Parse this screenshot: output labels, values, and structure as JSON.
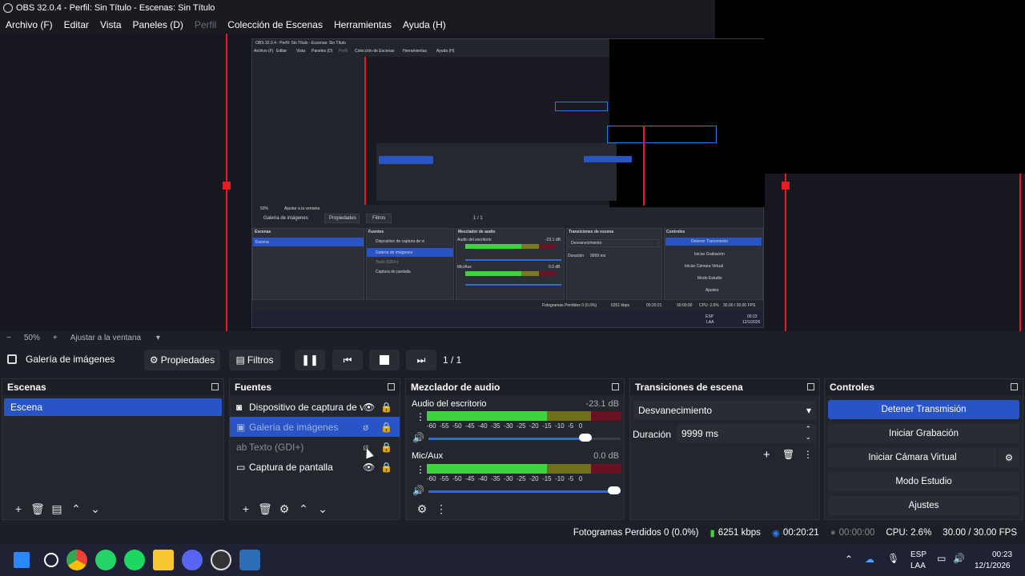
{
  "window": {
    "title": "OBS 32.0.4 - Perfil: Sin Título - Escenas: Sin Título"
  },
  "menu": [
    "Archivo (F)",
    "Editar",
    "Vista",
    "Paneles (D)",
    "Perfil",
    "Colección de Escenas",
    "Herramientas",
    "Ayuda (H)"
  ],
  "zoom": {
    "minus": "−",
    "value": "50%",
    "plus": "+",
    "fit": "Ajustar a la ventana"
  },
  "toolbar": {
    "source_name": "Galería de imágenes",
    "properties": "Propiedades",
    "filters": "Filtros",
    "slide_counter": "1 / 1"
  },
  "docks": {
    "scenes": {
      "title": "Escenas",
      "items": [
        "Escena"
      ]
    },
    "sources": {
      "title": "Fuentes",
      "items": [
        {
          "label": "Dispositivo de captura de vi",
          "icon": "camera-icon"
        },
        {
          "label": "Galería de imágenes",
          "icon": "image-icon"
        },
        {
          "label": "Texto (GDI+)",
          "icon": "text-icon"
        },
        {
          "label": "Captura de pantalla",
          "icon": "monitor-icon"
        }
      ]
    },
    "mixer": {
      "title": "Mezclador de audio",
      "channels": [
        {
          "name": "Audio del escritorio",
          "db": "-23.1 dB",
          "volume_fraction": 0.85
        },
        {
          "name": "Mic/Aux",
          "db": "0.0 dB",
          "volume_fraction": 1.0
        }
      ],
      "scale": [
        "-60",
        "-55",
        "-50",
        "-45",
        "-40",
        "-35",
        "-30",
        "-25",
        "-20",
        "-15",
        "-10",
        "-5",
        "0"
      ]
    },
    "transitions": {
      "title": "Transiciones de escena",
      "selected": "Desvanecimiento",
      "duration_label": "Duración",
      "duration_value": "9999 ms"
    },
    "controls": {
      "title": "Controles",
      "buttons": [
        "Detener Transmisión",
        "Iniciar Grabación",
        "Iniciar Cámara Virtual",
        "Modo Estudio",
        "Ajustes"
      ]
    }
  },
  "status": {
    "dropped": "Fotogramas Perdidos 0 (0.0%)",
    "bitrate": "6251 kbps",
    "stream_time": "00:20:21",
    "rec_time": "00:00:00",
    "cpu": "CPU: 2.6%",
    "fps": "30.00 / 30.00 FPS"
  },
  "taskbar": {
    "lang": "ESP",
    "layout": "LAA",
    "time": "00:23",
    "date": "12/1/2026"
  },
  "nested_preview": {
    "title": "OBS 32.0.4 - Perfil: Sin Título - Escenas: Sin Título",
    "menu": [
      "Archivo (F)",
      "Editar",
      "Vista",
      "Paneles (D)",
      "Perfil",
      "Colección de Escenas",
      "Herramientas",
      "Ayuda (H)"
    ],
    "source": "Galería de imágenes",
    "props": "Propiedades",
    "filters": "Filtros",
    "counter": "1 / 1",
    "zoom": "50%",
    "fit": "Ajustar a la ventana",
    "scenes_title": "Escenas",
    "scene": "Escena",
    "sources_title": "Fuentes",
    "sources": [
      "Dispositivo de captura de vi",
      "Galería de imágenes",
      "Texto (GDI+)",
      "Captura de pantalla"
    ],
    "mixer_title": "Mezclador de audio",
    "ch1": "Audio del escritorio",
    "ch1db": "-23.1 dB",
    "ch2": "Mic/Aux",
    "ch2db": "0.0 dB",
    "trans_title": "Transiciones de escena",
    "trans": "Desvanecimiento",
    "duration": "Duración",
    "duration_val": "9999 ms",
    "controls_title": "Controles",
    "controls": [
      "Detener Transmisión",
      "Iniciar Grabación",
      "Iniciar Cámara Virtual",
      "Modo Estudio",
      "Ajustes"
    ],
    "status": "Fotogramas Perdidos 0 (0.0%)",
    "kbps": "6251 kbps",
    "time1": "00:20:21",
    "time2": "00:00:00",
    "cpu": "CPU: 2.6%",
    "fps": "30.00 / 30.00 FPS",
    "lang": "ESP",
    "layout": "LAA",
    "clock": "00:23",
    "date": "12/1/2026"
  },
  "colors": {
    "accent": "#2854c5",
    "red_border": "#e51c23",
    "bg": "#1d1f26",
    "dock": "#24262e"
  }
}
